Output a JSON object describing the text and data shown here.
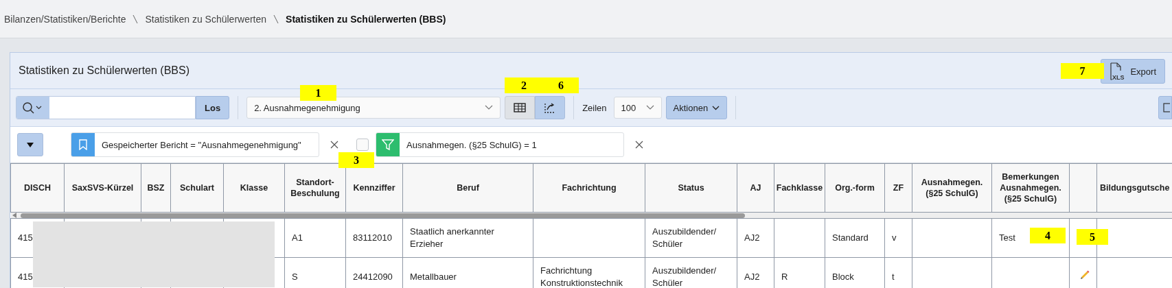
{
  "breadcrumb": [
    {
      "label": "Bilanzen/Statistiken/Berichte",
      "current": false
    },
    {
      "label": "Statistiken zu Schülerwerten",
      "current": false
    },
    {
      "label": "Statistiken zu Schülerwerten (BBS)",
      "current": true
    }
  ],
  "panel": {
    "title": "Statistiken zu Schülerwerten (BBS)",
    "export_button": "Export",
    "export_icon_text": "XLS"
  },
  "toolbar": {
    "search_button": "Los",
    "report": "2. Ausnahmegenehmigung",
    "views": [
      {
        "kind": "grid",
        "selected": true
      },
      {
        "kind": "chart",
        "selected": false
      }
    ],
    "rows_label": "Zeilen",
    "rows_value": "100",
    "actions_button": "Aktionen"
  },
  "filters": [
    {
      "kind": "saved",
      "text": "Gespeicherter Bericht = \"Ausnahmegenehmigung\""
    },
    {
      "kind": "filter",
      "text": "Ausnahmegen. (§25 SchulG) = 1",
      "checked": false
    }
  ],
  "table": {
    "columns": [
      {
        "label": "DISCH"
      },
      {
        "label": "SaxSVS-Kürzel"
      },
      {
        "label": "BSZ"
      },
      {
        "label": "Schulart"
      },
      {
        "label": "Klasse"
      },
      {
        "label": "Standort-Beschulung"
      },
      {
        "label": "Kennziffer"
      },
      {
        "label": "Beruf"
      },
      {
        "label": "Fachrichtung"
      },
      {
        "label": "Status"
      },
      {
        "label": "AJ"
      },
      {
        "label": "Fachklasse"
      },
      {
        "label": "Org.-form"
      },
      {
        "label": "ZF"
      },
      {
        "label": "Ausnahmegen. (§25 SchulG)"
      },
      {
        "label": "Bemerkungen Ausnahmegen. (§25 SchulG)"
      },
      {
        "kind": "edit"
      },
      {
        "label": "Bildungsgutsche"
      }
    ],
    "rows": [
      {
        "cells": [
          "415",
          "",
          "",
          "",
          "",
          "A1",
          "83112010",
          "Staatlich anerkannter Erzieher",
          "",
          "Auszubildender/ Schüler",
          "AJ2",
          "",
          "Standard",
          "v",
          "",
          "Test",
          "",
          ""
        ]
      },
      {
        "cells": [
          "415",
          "",
          "",
          "",
          "",
          "S",
          "24412090",
          "Metallbauer",
          "Fachrichtung Konstruktionstechnik",
          "Auszubildender/ Schüler",
          "AJ2",
          "R",
          "Block",
          "t",
          "",
          "",
          "",
          ""
        ]
      }
    ]
  },
  "callouts": [
    {
      "label": "1"
    },
    {
      "label": "2"
    },
    {
      "label": "6"
    },
    {
      "label": "7"
    },
    {
      "label": "3"
    },
    {
      "label": "4"
    },
    {
      "label": "5"
    }
  ]
}
